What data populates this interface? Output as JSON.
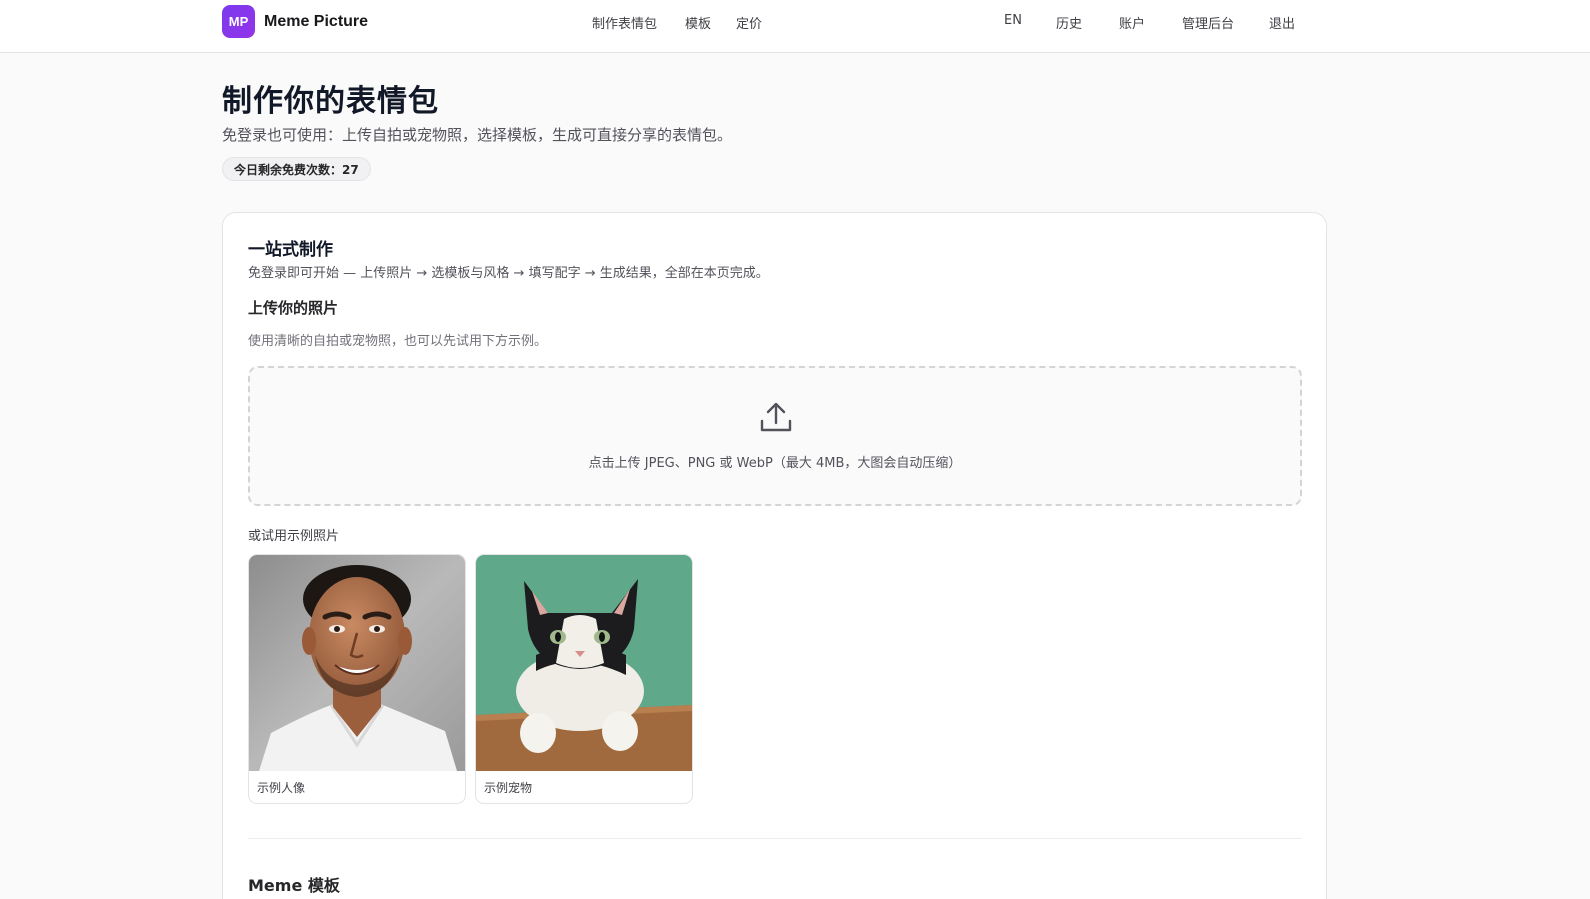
{
  "header": {
    "logo_text": "MP",
    "brand": "Meme Picture",
    "nav": [
      "制作表情包",
      "模板",
      "定价"
    ],
    "right": [
      "EN",
      "历史",
      "账户",
      "管理后台",
      "退出"
    ]
  },
  "hero": {
    "title": "制作你的表情包",
    "subtitle": "免登录也可使用：上传自拍或宠物照，选择模板，生成可直接分享的表情包。",
    "quota": "今日剩余免费次数：27"
  },
  "card": {
    "title": "一站式制作",
    "desc": "免登录即可开始 — 上传照片 → 选模板与风格 → 填写配字 → 生成结果，全部在本页完成。",
    "upload": {
      "title": "上传你的照片",
      "hint": "使用清晰的自拍或宠物照，也可以先试用下方示例。",
      "dropzone_text": "点击上传 JPEG、PNG 或 WebP（最大 4MB，大图会自动压缩）"
    },
    "samples_label": "或试用示例照片",
    "samples": [
      {
        "caption": "示例人像"
      },
      {
        "caption": "示例宠物"
      }
    ],
    "templates_title": "Meme 模板"
  },
  "colors": {
    "accent": "#7c3aed",
    "pet_background": "#5fa98a"
  }
}
